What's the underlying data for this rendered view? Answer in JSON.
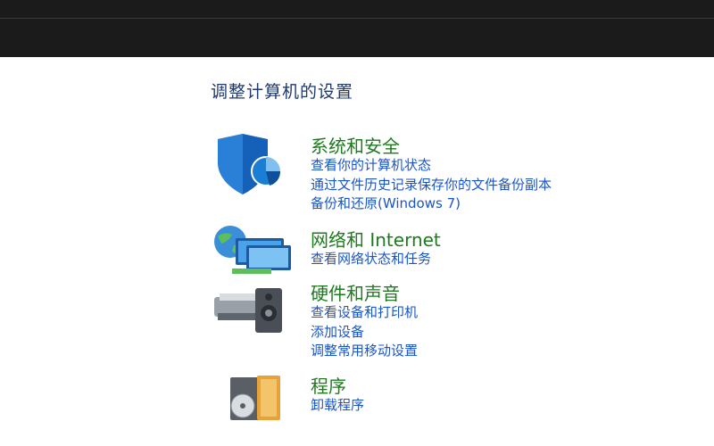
{
  "header": {
    "title": "调整计算机的设置"
  },
  "categories": [
    {
      "title": "系统和安全",
      "icon": "shield-icon",
      "links": [
        "查看你的计算机状态",
        "通过文件历史记录保存你的文件备份副本",
        "备份和还原(Windows 7)"
      ]
    },
    {
      "title": "网络和 Internet",
      "icon": "network-icon",
      "links": [
        "查看网络状态和任务"
      ]
    },
    {
      "title": "硬件和声音",
      "icon": "printer-icon",
      "links": [
        "查看设备和打印机",
        "添加设备",
        "调整常用移动设置"
      ]
    },
    {
      "title": "程序",
      "icon": "programs-icon",
      "links": [
        "卸载程序"
      ]
    }
  ],
  "colors": {
    "title_bar": "#1b1b1b",
    "heading": "#1e3a6e",
    "category_title": "#1f7a1f",
    "link": "#1a55c8"
  }
}
